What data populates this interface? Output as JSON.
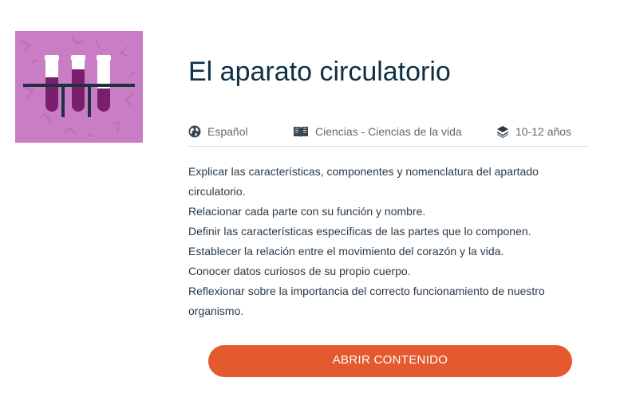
{
  "course": {
    "title": "El aparato circulatorio",
    "thumbnail_icon": "test-tubes-icon",
    "thumbnail_background": "#c97dc4",
    "meta": {
      "language_icon": "globe-icon",
      "language": "Español",
      "subject_icon": "open-book-icon",
      "subject": "Ciencias - Ciencias de la vida",
      "age_icon": "layers-icon",
      "age": "10-12 años"
    },
    "objectives": [
      "Explicar las características, componentes y nomenclatura del apartado circulatorio.",
      "Relacionar cada parte con su función y nombre.",
      "Definir las características específicas de las partes que lo componen.",
      "Establecer la relación entre el movimiento del corazón y la vida.",
      "Conocer datos curiosos de su propio cuerpo.",
      "Reflexionar sobre la importancia del correcto funcionamiento de nuestro organismo."
    ],
    "open_button_label": "ABRIR CONTENIDO"
  },
  "colors": {
    "title": "#0f2f45",
    "button": "#e5592f",
    "tube_fill": "#7a1f6e",
    "rack": "#1e3340"
  }
}
